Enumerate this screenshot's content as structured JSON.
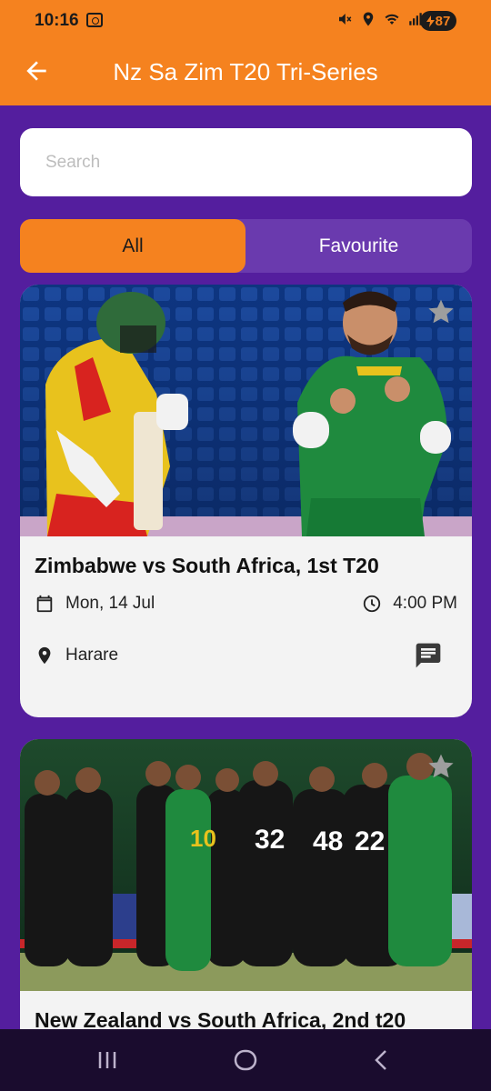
{
  "status_bar": {
    "time": "10:16",
    "battery": "87",
    "icons": [
      "screenshot-icon",
      "mute-icon",
      "location-icon",
      "wifi-icon",
      "signal-icon",
      "battery-charging-icon"
    ]
  },
  "app_bar": {
    "title": "Nz Sa Zim T20 Tri-Series",
    "back_icon": "arrow-left-icon"
  },
  "search": {
    "placeholder": "Search",
    "value": ""
  },
  "tabs": [
    {
      "label": "All",
      "selected": true
    },
    {
      "label": "Favourite",
      "selected": false
    }
  ],
  "matches": [
    {
      "title": "Zimbabwe vs South Africa, 1st T20",
      "date": "Mon, 14 Jul",
      "time": "4:00 PM",
      "venue": "Harare",
      "favourite": false
    },
    {
      "title": "New Zealand vs South Africa, 2nd t20",
      "favourite": false
    }
  ],
  "colors": {
    "primary": "#F5821F",
    "background": "#541E9E",
    "tab_track": "#6A3AAE",
    "card": "#F3F3F3"
  },
  "nav_bar": {
    "buttons": [
      "recents-icon",
      "home-icon",
      "back-icon"
    ]
  }
}
